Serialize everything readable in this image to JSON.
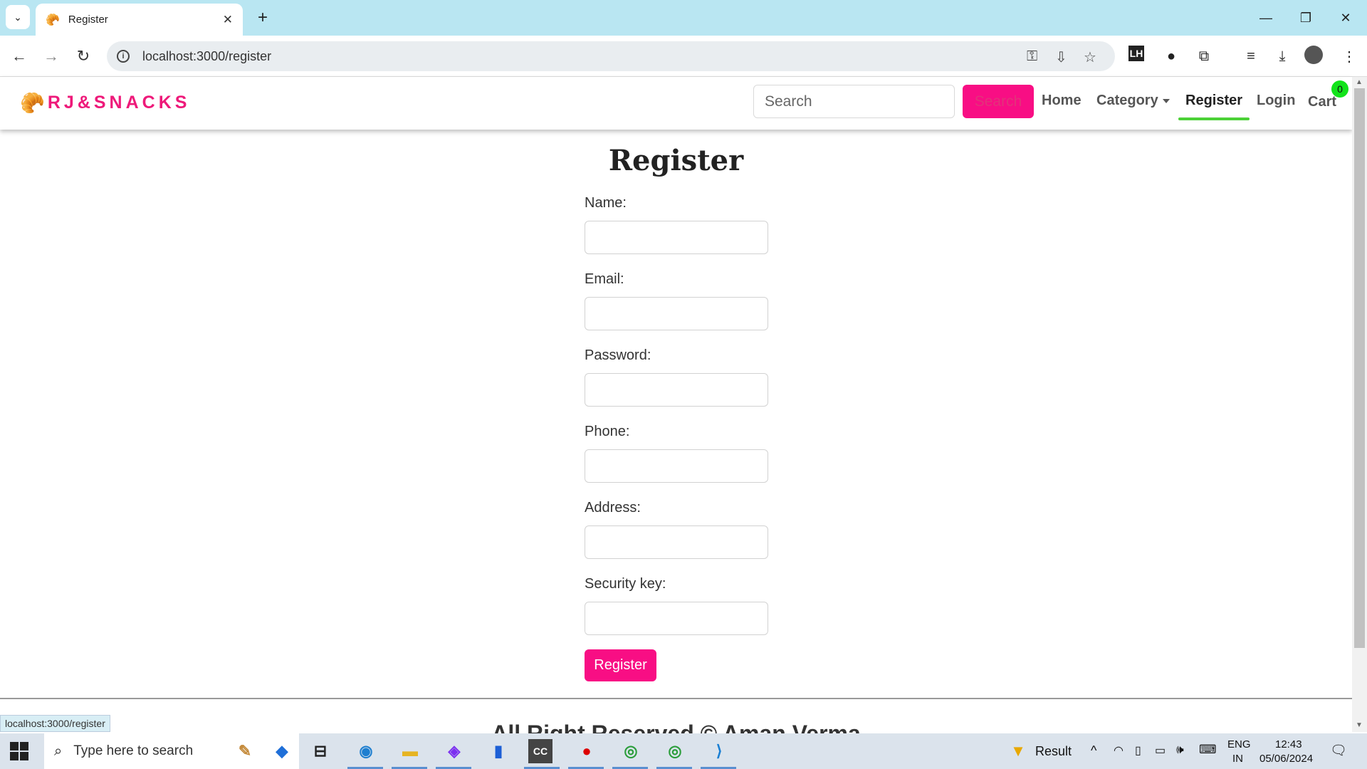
{
  "browser": {
    "tab_title": "Register",
    "url": "localhost:3000/register",
    "status_url": "localhost:3000/register"
  },
  "site": {
    "brand": "RJ&SNACKS",
    "search_placeholder": "Search",
    "search_button": "Search",
    "nav": {
      "home": "Home",
      "category": "Category",
      "register": "Register",
      "login": "Login",
      "cart": "Cart",
      "cart_count": "0"
    }
  },
  "form": {
    "title": "Register",
    "fields": {
      "name": "Name:",
      "email": "Email:",
      "password": "Password:",
      "phone": "Phone:",
      "address": "Address:",
      "security": "Security key:"
    },
    "submit": "Register"
  },
  "footer": {
    "text": "All Right Reserved © Aman Verma"
  },
  "taskbar": {
    "search_placeholder": "Type here to search",
    "result": "Result",
    "lang": "ENG",
    "region": "IN",
    "time": "12:43",
    "date": "05/06/2024"
  },
  "colors": {
    "brand": "#ee1a7a",
    "button": "#f80e84",
    "active_underline": "#4cd137",
    "cart_badge": "#12e31a"
  }
}
